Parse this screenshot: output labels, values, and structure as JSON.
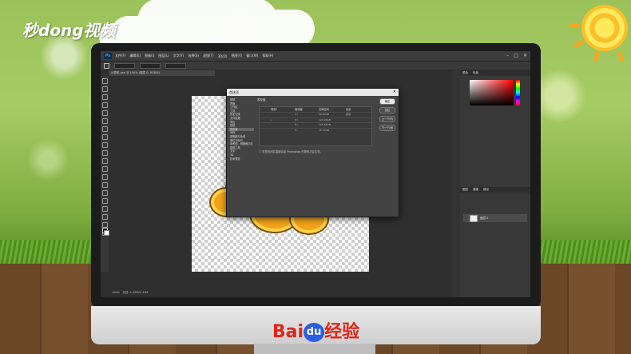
{
  "watermark": {
    "top_logo": "秒dong视频"
  },
  "footer_brand": {
    "bai": "Bai",
    "du": "du",
    "jingyan": "经验"
  },
  "photoshop": {
    "app_icon": "Ps",
    "menu": [
      "文件(F)",
      "编辑(E)",
      "图像(I)",
      "图层(L)",
      "文字(Y)",
      "选择(S)",
      "滤镜(T)",
      "3D(D)",
      "视图(V)",
      "窗口(W)",
      "帮助(H)"
    ],
    "window_controls": [
      "–",
      "□",
      "✕"
    ],
    "document_tab": "计算机.psd @ 100% (图层 0, RGB/8)",
    "status_left": "100%",
    "status_doc": "文档: 1.43M/1.43M",
    "right_panel": {
      "color_tabs": [
        "颜色",
        "色板"
      ],
      "layer_tabs": [
        "图层",
        "通道",
        "路径"
      ],
      "layer_name": "图层 0"
    },
    "dialog": {
      "title": "首选项",
      "close": "✕",
      "nav": [
        "常规",
        "界面",
        "工作区",
        "工具",
        "历史记录",
        "文件处理",
        "导出",
        "性能",
        "暂存盘",
        "光标",
        "透明度与色域",
        "单位与标尺",
        "参考线、网格和切片",
        "增效工具",
        "文字",
        "3D",
        "技术预览"
      ],
      "selected_index": 8,
      "section": "暂存盘",
      "table_headers": [
        "现用?",
        "驱动器",
        "空闲空间",
        "信息"
      ],
      "rows": [
        {
          "active": "",
          "drive": "C:\\",
          "free": "30.60GB",
          "info": "启动"
        },
        {
          "active": "✓",
          "drive": "D:\\",
          "free": "120.00GB",
          "info": ""
        },
        {
          "active": "",
          "drive": "E:\\",
          "free": "105.65GB",
          "info": ""
        },
        {
          "active": "",
          "drive": "F:\\",
          "free": "75.12GB",
          "info": ""
        }
      ],
      "note": "在您关闭并重新启动 Photoshop 时更改才会生效。",
      "buttons": [
        "确定",
        "复位",
        "上一个(P)",
        "下一个(N)"
      ]
    }
  }
}
